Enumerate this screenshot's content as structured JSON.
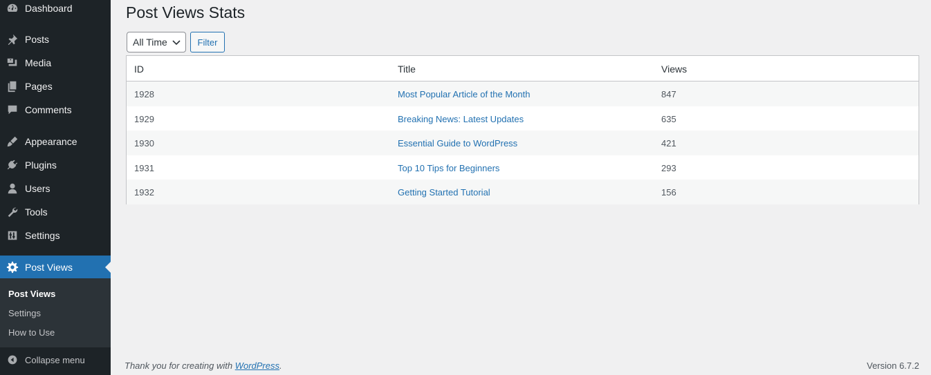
{
  "sidebar": {
    "items": [
      {
        "label": "Dashboard",
        "icon": "dashboard-icon"
      },
      {
        "label": "Posts",
        "icon": "pin-icon"
      },
      {
        "label": "Media",
        "icon": "media-icon"
      },
      {
        "label": "Pages",
        "icon": "pages-icon"
      },
      {
        "label": "Comments",
        "icon": "comments-icon"
      },
      {
        "label": "Appearance",
        "icon": "brush-icon"
      },
      {
        "label": "Plugins",
        "icon": "plugin-icon"
      },
      {
        "label": "Users",
        "icon": "user-icon"
      },
      {
        "label": "Tools",
        "icon": "wrench-icon"
      },
      {
        "label": "Settings",
        "icon": "settings-sliders-icon"
      },
      {
        "label": "Post Views",
        "icon": "gear-icon"
      }
    ],
    "submenu": [
      "Post Views",
      "Settings",
      "How to Use"
    ],
    "collapse_label": "Collapse menu"
  },
  "page": {
    "title": "Post Views Stats",
    "period_select": "All Time",
    "filter_label": "Filter"
  },
  "table": {
    "headers": [
      "ID",
      "Title",
      "Views"
    ],
    "rows": [
      {
        "id": "1928",
        "title": "Most Popular Article of the Month",
        "views": "847"
      },
      {
        "id": "1929",
        "title": "Breaking News: Latest Updates",
        "views": "635"
      },
      {
        "id": "1930",
        "title": "Essential Guide to WordPress",
        "views": "421"
      },
      {
        "id": "1931",
        "title": "Top 10 Tips for Beginners",
        "views": "293"
      },
      {
        "id": "1932",
        "title": "Getting Started Tutorial",
        "views": "156"
      }
    ]
  },
  "footer": {
    "thanks_prefix": "Thank you for creating with ",
    "thanks_link": "WordPress",
    "thanks_suffix": ".",
    "version": "Version 6.7.2"
  },
  "colors": {
    "sidebar_bg": "#1d2327",
    "accent": "#2271b1",
    "page_bg": "#f0f0f1"
  }
}
